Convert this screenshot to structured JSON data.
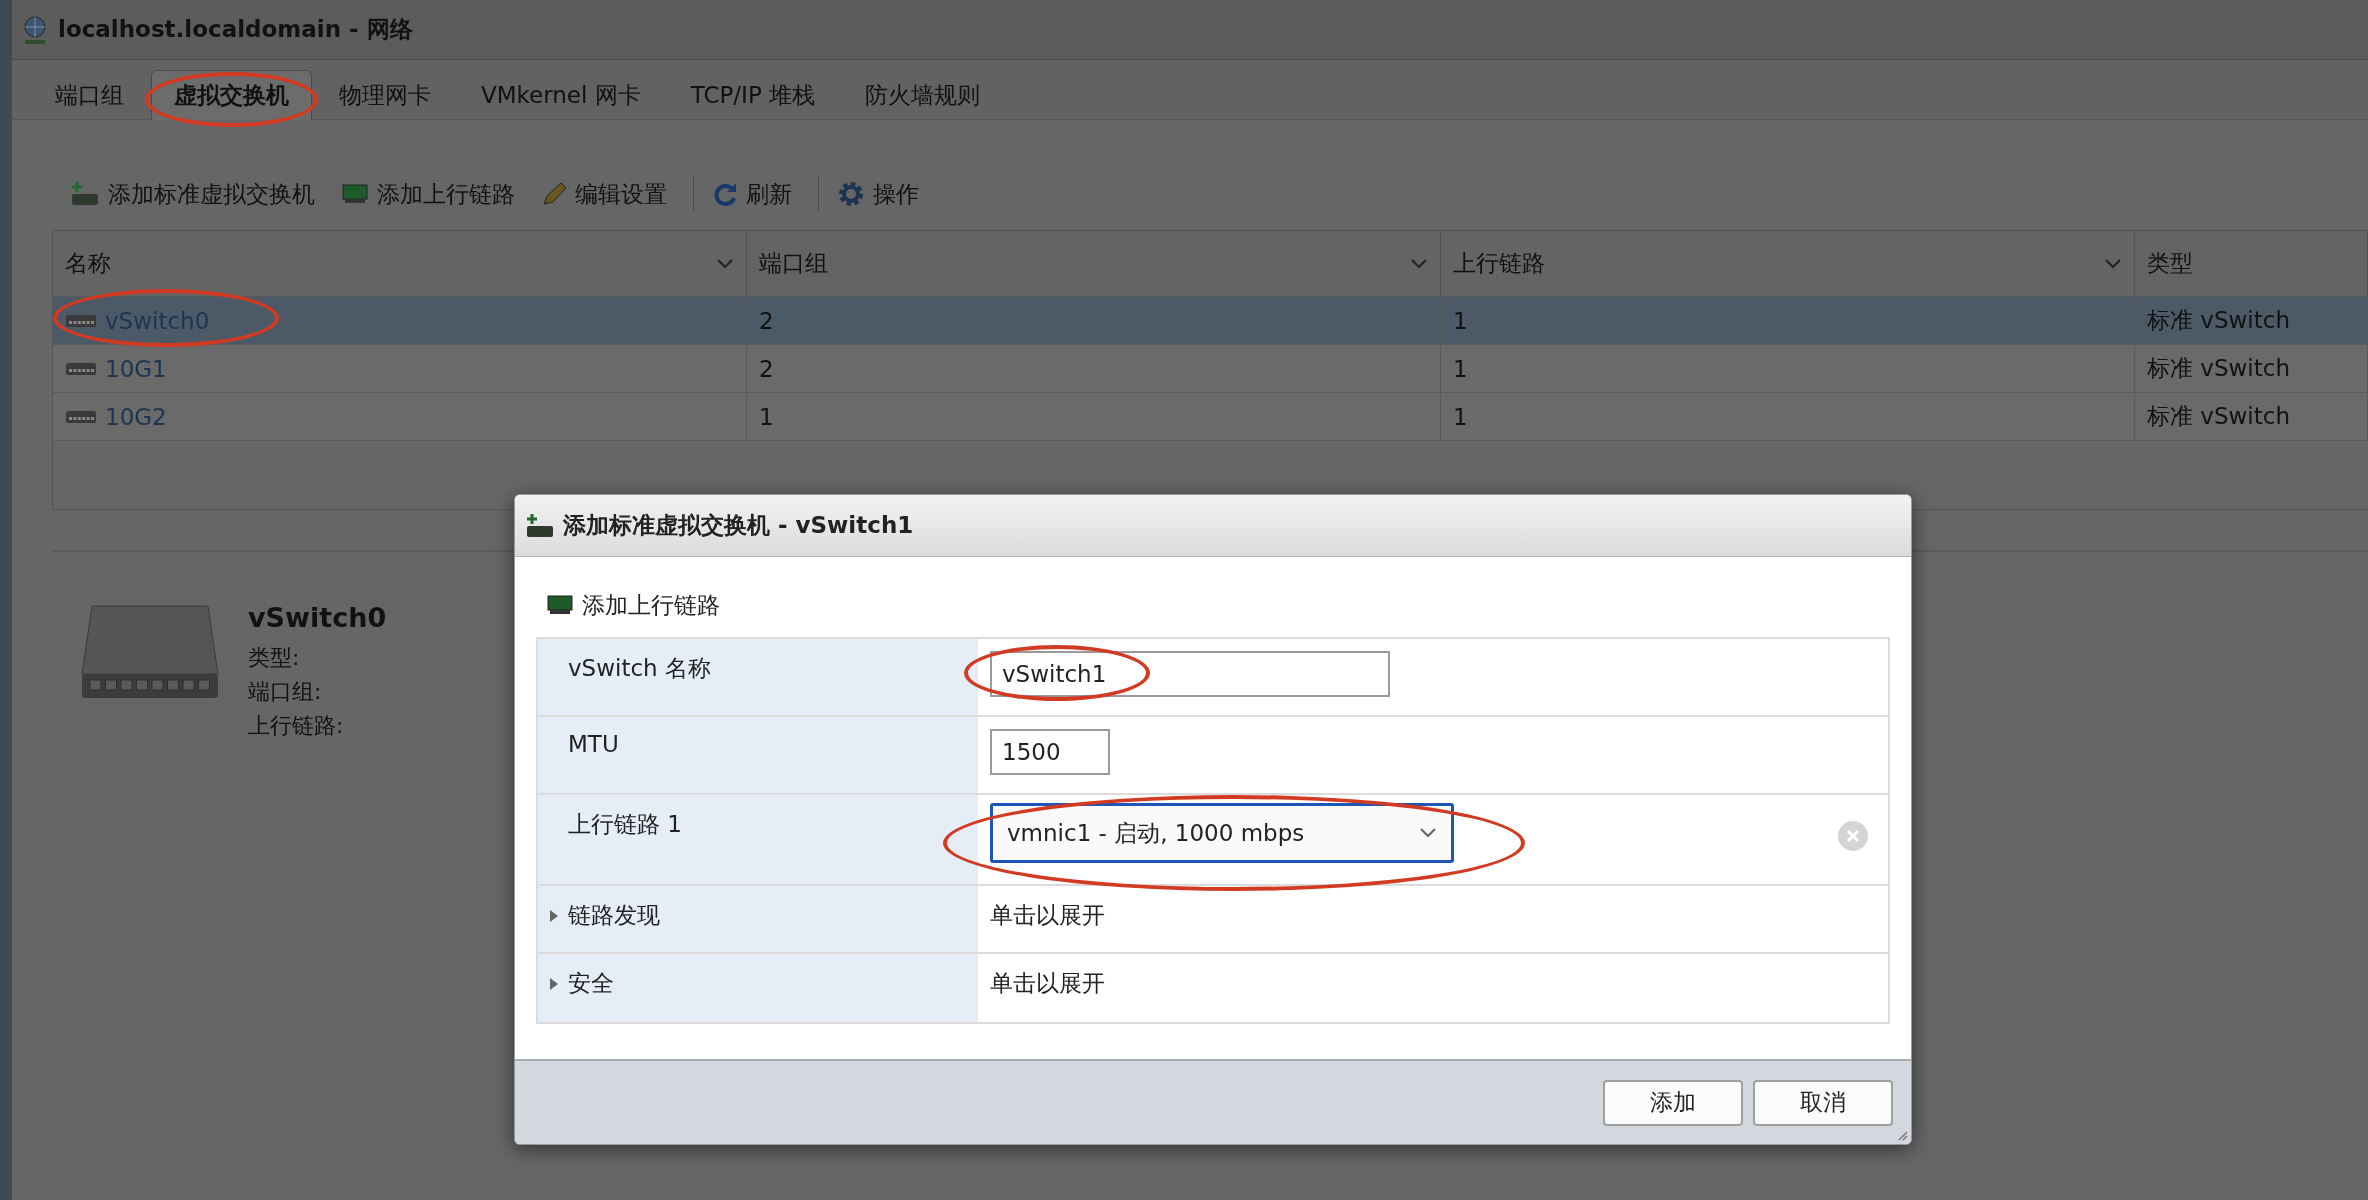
{
  "window": {
    "title": "localhost.localdomain - 网络"
  },
  "tabs": [
    {
      "label": "端口组",
      "selected": false,
      "circled": false
    },
    {
      "label": "虚拟交换机",
      "selected": true,
      "circled": true
    },
    {
      "label": "物理网卡",
      "selected": false,
      "circled": false
    },
    {
      "label": "VMkernel 网卡",
      "selected": false,
      "circled": false
    },
    {
      "label": "TCP/IP 堆栈",
      "selected": false,
      "circled": false
    },
    {
      "label": "防火墙规则",
      "selected": false,
      "circled": false
    }
  ],
  "toolbar": [
    {
      "kind": "add-switch",
      "label": "添加标准虚拟交换机",
      "separator_before": false
    },
    {
      "kind": "add-uplink",
      "label": "添加上行链路",
      "separator_before": false
    },
    {
      "kind": "edit",
      "label": "编辑设置",
      "separator_before": false
    },
    {
      "kind": "refresh",
      "label": "刷新",
      "separator_before": true
    },
    {
      "kind": "actions",
      "label": "操作",
      "separator_before": true
    }
  ],
  "table": {
    "columns": [
      {
        "label": "名称",
        "sortable": true
      },
      {
        "label": "端口组",
        "sortable": true
      },
      {
        "label": "上行链路",
        "sortable": true
      },
      {
        "label": "类型",
        "sortable": false
      }
    ],
    "rows": [
      {
        "cells": [
          "vSwitch0",
          "2",
          "1",
          "标准 vSwitch"
        ],
        "selected": true,
        "circled": true
      },
      {
        "cells": [
          "10G1",
          "2",
          "1",
          "标准 vSwitch"
        ],
        "selected": false,
        "circled": false
      },
      {
        "cells": [
          "10G2",
          "1",
          "1",
          "标准 vSwitch"
        ],
        "selected": false,
        "circled": false
      }
    ]
  },
  "detail": {
    "name": "vSwitch0",
    "fields": [
      "类型:",
      "端口组:",
      "上行链路:"
    ]
  },
  "dialog": {
    "title": "添加标准虚拟交换机 - vSwitch1",
    "add_uplink": "添加上行链路",
    "rows": [
      {
        "kind": "text",
        "label": "vSwitch 名称",
        "value": "vSwitch1",
        "circled": true
      },
      {
        "kind": "number",
        "label": "MTU",
        "value": "1500",
        "circled": false
      },
      {
        "kind": "select",
        "label": "上行链路 1",
        "value": "vmnic1 - 启动, 1000 mbps",
        "circled": true
      },
      {
        "kind": "expander",
        "label": "链路发现",
        "value": "单击以展开",
        "expanded": false
      },
      {
        "kind": "expander",
        "label": "安全",
        "value": "单击以展开",
        "expanded": false
      }
    ],
    "buttons": [
      "添加",
      "取消"
    ]
  }
}
